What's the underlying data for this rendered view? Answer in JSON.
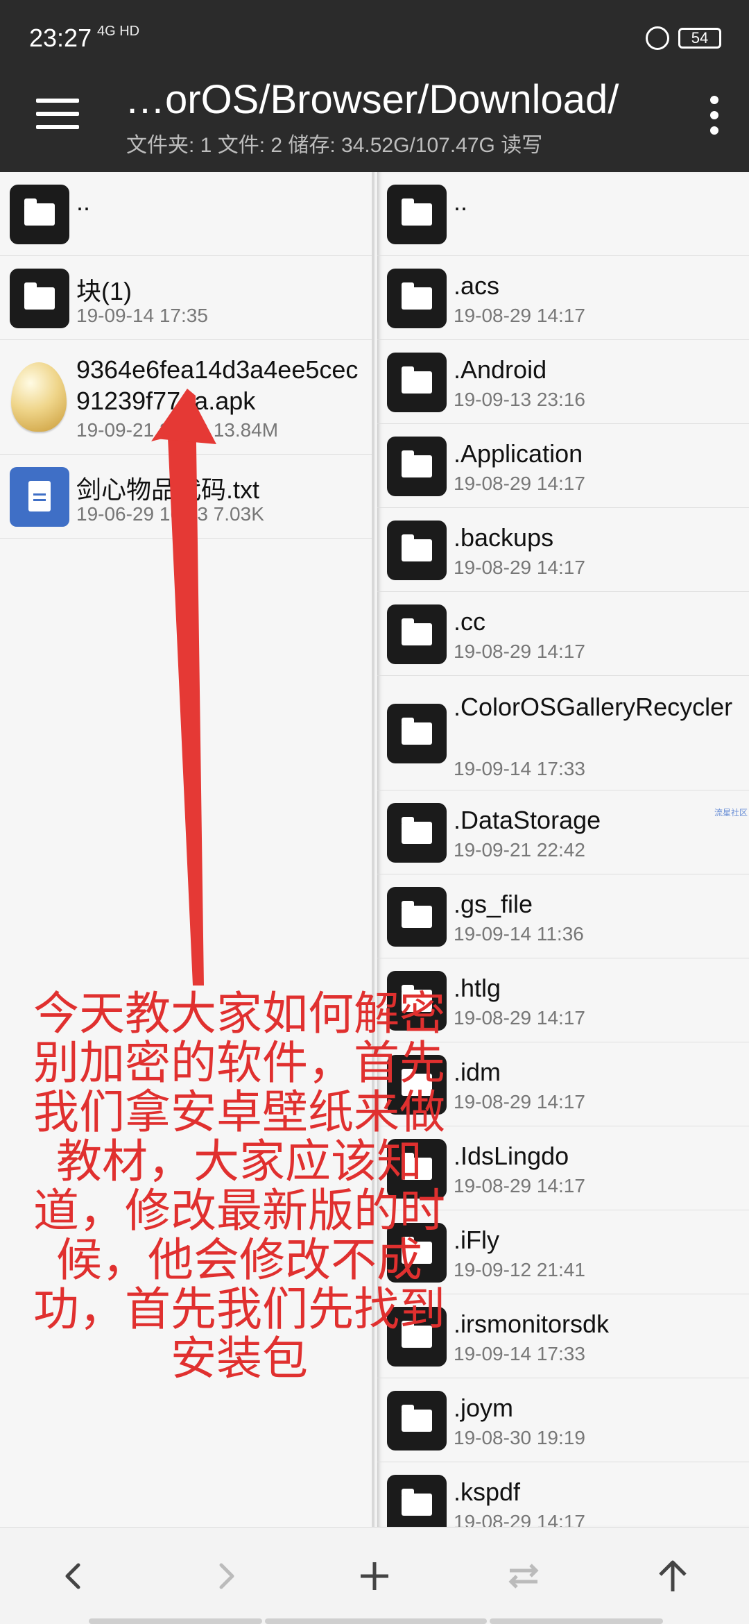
{
  "status_bar": {
    "time": "23:27",
    "signal_label": "4G HD",
    "battery": "54"
  },
  "toolbar": {
    "path": "…orOS/Browser/Download/",
    "summary": "文件夹: 1  文件: 2  储存: 34.52G/107.47G  读写"
  },
  "left_pane": {
    "items": [
      {
        "name": "..",
        "meta": "",
        "icon": "folder-icon"
      },
      {
        "name": "块(1)",
        "meta": "19-09-14 17:35",
        "icon": "folder-icon"
      },
      {
        "name": "9364e6fea14d3a4ee5cec91239f771a.apk",
        "meta": "19-09-21 23:26  13.84M",
        "icon": "apk-egg-icon"
      },
      {
        "name": "剑心物品代码.txt",
        "meta": "19-06-29 16:43  7.03K",
        "icon": "text-file-icon"
      }
    ]
  },
  "right_pane": {
    "items": [
      {
        "name": "..",
        "meta": ""
      },
      {
        "name": ".acs",
        "meta": "19-08-29 14:17"
      },
      {
        "name": ".Android",
        "meta": "19-09-13 23:16"
      },
      {
        "name": ".Application",
        "meta": "19-08-29 14:17"
      },
      {
        "name": ".backups",
        "meta": "19-08-29 14:17"
      },
      {
        "name": ".cc",
        "meta": "19-08-29 14:17"
      },
      {
        "name": ".ColorOSGalleryRecycler",
        "meta": "19-09-14 17:33"
      },
      {
        "name": ".DataStorage",
        "meta": "19-09-21 22:42"
      },
      {
        "name": ".gs_file",
        "meta": "19-09-14 11:36"
      },
      {
        "name": ".htlg",
        "meta": "19-08-29 14:17"
      },
      {
        "name": ".idm",
        "meta": "19-08-29 14:17"
      },
      {
        "name": ".IdsLingdo",
        "meta": "19-08-29 14:17"
      },
      {
        "name": ".iFly",
        "meta": "19-09-12 21:41"
      },
      {
        "name": ".irsmonitorsdk",
        "meta": "19-09-14 17:33"
      },
      {
        "name": ".joym",
        "meta": "19-08-30 19:19"
      },
      {
        "name": ".kspdf",
        "meta": "19-08-29 14:17"
      }
    ]
  },
  "watermark": "流星社区",
  "annotation": {
    "text": "今天教大家如何解密别加密的软件，首先我们拿安卓壁纸来做教材，大家应该知道，修改最新版的时候，他会修改不成功，首先我们先找到安装包",
    "color": "#e0302f"
  },
  "bottom_bar": {
    "buttons": [
      "back-icon",
      "forward-icon",
      "add-icon",
      "swap-icon",
      "up-icon"
    ]
  }
}
